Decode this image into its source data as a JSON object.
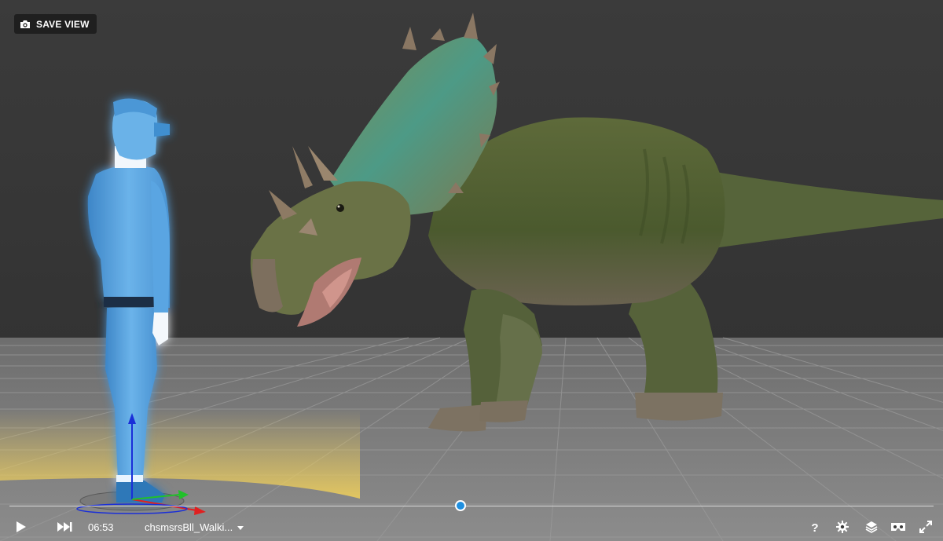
{
  "toolbar": {
    "save_view_label": "SAVE VIEW"
  },
  "player": {
    "time": "06:53",
    "animation_name": "chsmsrsBll_Walki...",
    "progress": 0.488
  },
  "icons": {
    "camera": "camera-icon",
    "play": "play-icon",
    "next": "skip-forward-icon",
    "dropdown": "chevron-down-icon",
    "help": "help-icon",
    "settings": "gear-icon",
    "layers": "layers-icon",
    "vr": "vr-headset-icon",
    "fullscreen": "fullscreen-icon"
  },
  "colors": {
    "background": "#3a3a3a",
    "accent": "#1e8fe0",
    "human_figure": "#5aa8e0",
    "highlight": "#f2d15a"
  },
  "labels": {
    "help_glyph": "?"
  }
}
